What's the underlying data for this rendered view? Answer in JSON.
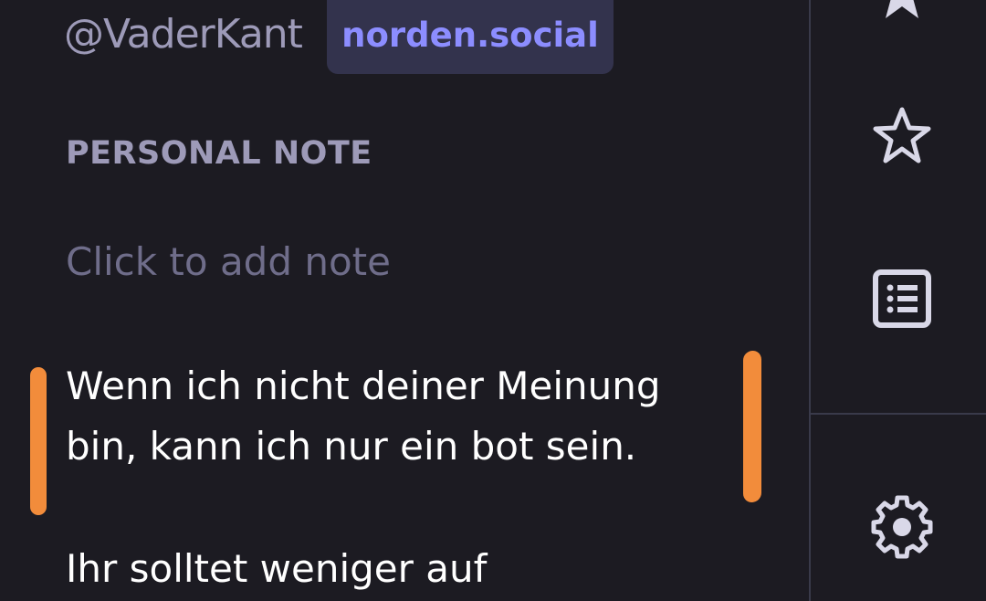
{
  "account": {
    "handle": "@VaderKant",
    "domain": "norden.social"
  },
  "personal_note": {
    "label": "PERSONAL NOTE",
    "placeholder": "Click to add note"
  },
  "bio": {
    "line1": "Wenn ich nicht deiner Meinung bin, kann ich nur ein bot sein.",
    "line2": "Ihr solltet weniger auf"
  },
  "highlight": {
    "color": "#f28c3b"
  },
  "rail": {
    "icons": [
      "bookmark-star-icon",
      "favourites-star-icon",
      "lists-icon",
      "settings-gear-icon"
    ]
  },
  "colors": {
    "background": "#1c1b22",
    "badge_background": "#33334d",
    "badge_text": "#8c8dff",
    "muted_text": "#9d9ab8"
  }
}
